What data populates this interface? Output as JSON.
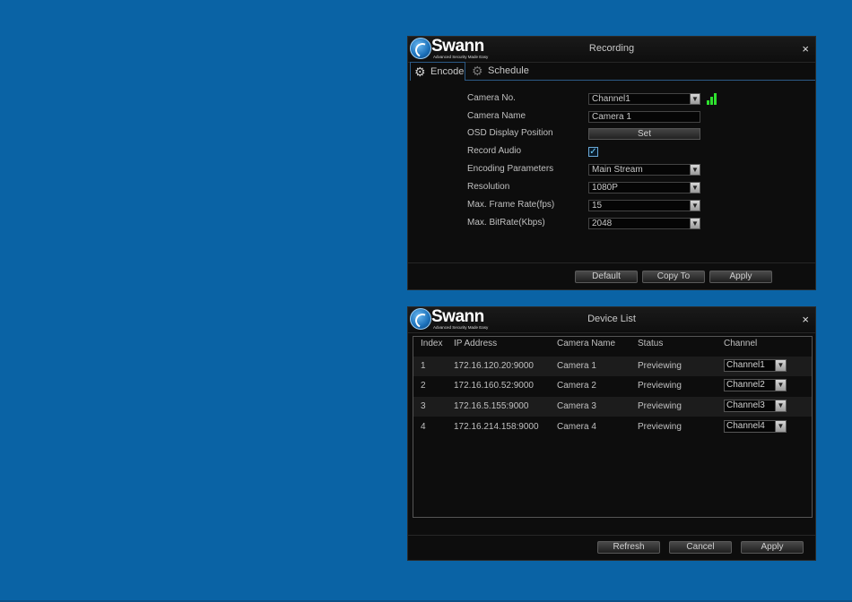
{
  "recording": {
    "title": "Recording",
    "logo": {
      "word": "Swann",
      "tagline": "Advanced Security Made Easy"
    },
    "close": "×",
    "tabs": [
      {
        "label": "Encode",
        "active": true
      },
      {
        "label": "Schedule",
        "active": false
      }
    ],
    "form": {
      "camera_no_label": "Camera No.",
      "camera_no_value": "Channel1",
      "camera_name_label": "Camera Name",
      "camera_name_value": "Camera 1",
      "osd_label": "OSD Display Position",
      "osd_button": "Set",
      "record_audio_label": "Record Audio",
      "record_audio_checked": true,
      "encoding_label": "Encoding Parameters",
      "encoding_value": "Main Stream",
      "resolution_label": "Resolution",
      "resolution_value": "1080P",
      "frame_rate_label": "Max. Frame Rate(fps)",
      "frame_rate_value": "15",
      "bitrate_label": "Max. BitRate(Kbps)",
      "bitrate_value": "2048"
    },
    "buttons": {
      "default": "Default",
      "copy_to": "Copy To",
      "apply": "Apply"
    }
  },
  "device_list": {
    "title": "Device List",
    "logo": {
      "word": "Swann",
      "tagline": "Advanced Security Made Easy"
    },
    "close": "×",
    "columns": [
      "Index",
      "IP Address",
      "Camera Name",
      "Status",
      "Channel"
    ],
    "rows": [
      {
        "index": "1",
        "ip": "172.16.120.20:9000",
        "name": "Camera 1",
        "status": "Previewing",
        "channel": "Channel1"
      },
      {
        "index": "2",
        "ip": "172.16.160.52:9000",
        "name": "Camera 2",
        "status": "Previewing",
        "channel": "Channel2"
      },
      {
        "index": "3",
        "ip": "172.16.5.155:9000",
        "name": "Camera 3",
        "status": "Previewing",
        "channel": "Channel3"
      },
      {
        "index": "4",
        "ip": "172.16.214.158:9000",
        "name": "Camera 4",
        "status": "Previewing",
        "channel": "Channel4"
      }
    ],
    "buttons": {
      "refresh": "Refresh",
      "cancel": "Cancel",
      "apply": "Apply"
    }
  },
  "icons": {
    "gear": "⚙",
    "dropdown": "▼",
    "check": "✓",
    "signal": "signal-strength-icon"
  },
  "colors": {
    "background": "#0a63a5",
    "panel": "#0d0d0d",
    "signal": "#2ee02e",
    "tab_border": "#2c5a86"
  }
}
